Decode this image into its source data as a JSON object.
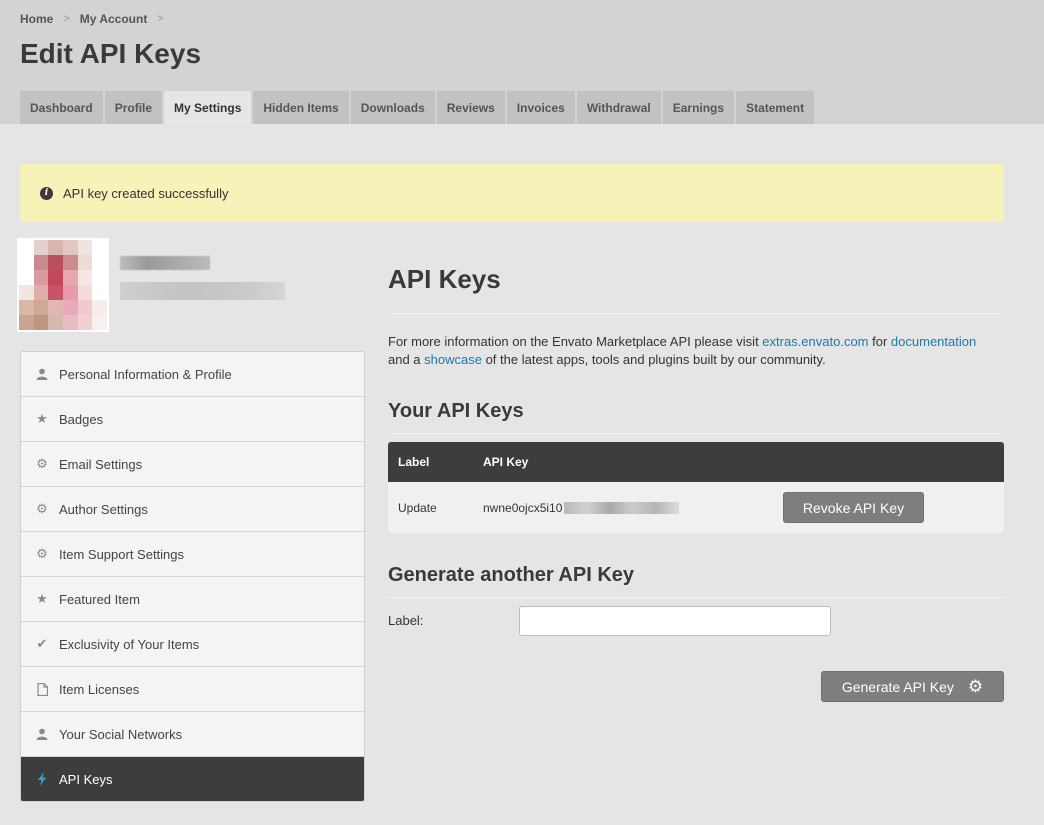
{
  "breadcrumb": {
    "home": "Home",
    "account": "My Account",
    "separator": ">"
  },
  "page_title": "Edit API Keys",
  "tabs": [
    {
      "label": "Dashboard",
      "active": false
    },
    {
      "label": "Profile",
      "active": false
    },
    {
      "label": "My Settings",
      "active": true
    },
    {
      "label": "Hidden Items",
      "active": false
    },
    {
      "label": "Downloads",
      "active": false
    },
    {
      "label": "Reviews",
      "active": false
    },
    {
      "label": "Invoices",
      "active": false
    },
    {
      "label": "Withdrawal",
      "active": false
    },
    {
      "label": "Earnings",
      "active": false
    },
    {
      "label": "Statement",
      "active": false
    }
  ],
  "alert": {
    "message": "API key created successfully",
    "icon": "info-icon"
  },
  "sidebar": {
    "items": [
      {
        "label": "Personal Information & Profile",
        "icon": "user-icon",
        "glyph": "👤"
      },
      {
        "label": "Badges",
        "icon": "star-icon",
        "glyph": "★"
      },
      {
        "label": "Email Settings",
        "icon": "gear-icon",
        "glyph": "⚙"
      },
      {
        "label": "Author Settings",
        "icon": "gear-icon",
        "glyph": "⚙"
      },
      {
        "label": "Item Support Settings",
        "icon": "gear-icon",
        "glyph": "⚙"
      },
      {
        "label": "Featured Item",
        "icon": "star-icon",
        "glyph": "★"
      },
      {
        "label": "Exclusivity of Your Items",
        "icon": "check-icon",
        "glyph": "✔"
      },
      {
        "label": "Item Licenses",
        "icon": "document-icon",
        "glyph": "🗋"
      },
      {
        "label": "Your Social Networks",
        "icon": "user-icon",
        "glyph": "👤"
      },
      {
        "label": "API Keys",
        "icon": "lightning-icon",
        "glyph": "⚡",
        "active": true
      }
    ]
  },
  "main": {
    "title": "API Keys",
    "info": {
      "part1": "For more information on the Envato Marketplace API please visit ",
      "link1": "extras.envato.com",
      "part2": " for ",
      "link2": "documentation",
      "part3": " and a ",
      "link3": "showcase",
      "part4": " of the latest apps, tools and plugins built by our community."
    },
    "your_keys_title": "Your API Keys",
    "table": {
      "headers": {
        "label": "Label",
        "key": "API Key"
      },
      "rows": [
        {
          "label": "Update",
          "key_visible": "nwne0ojcx5i10",
          "revoke_label": "Revoke API Key"
        }
      ]
    },
    "generate_title": "Generate another API Key",
    "label_field": {
      "label": "Label:",
      "value": "",
      "placeholder": ""
    },
    "generate_label": "Generate API Key"
  },
  "colors": {
    "accent_link": "#1a7ab0",
    "active_menu_bg": "#3d3d3d",
    "alert_bg": "#f6f2b8",
    "button_bg": "#7e7e7e"
  }
}
